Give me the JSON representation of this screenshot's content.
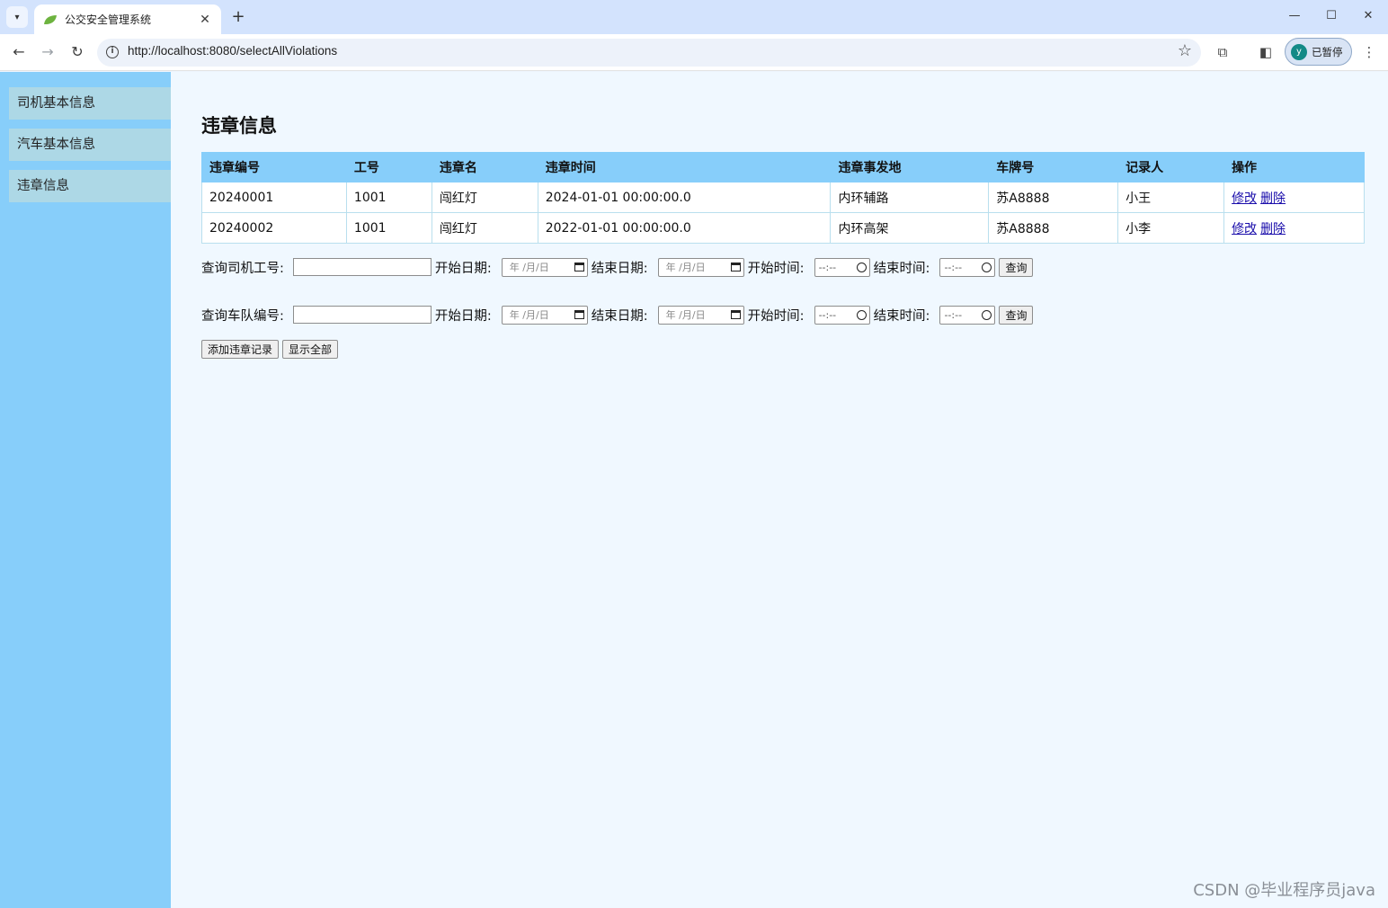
{
  "browser": {
    "tab_title": "公交安全管理系统",
    "url": "http://localhost:8080/selectAllViolations",
    "profile_initial": "y",
    "profile_label": "已暂停"
  },
  "sidebar": {
    "items": [
      {
        "label": "司机基本信息"
      },
      {
        "label": "汽车基本信息"
      },
      {
        "label": "违章信息"
      }
    ]
  },
  "main": {
    "title": "违章信息",
    "table": {
      "headers": [
        "违章编号",
        "工号",
        "违章名",
        "违章时间",
        "违章事发地",
        "车牌号",
        "记录人",
        "操作"
      ],
      "rows": [
        {
          "id": "20240001",
          "worker_no": "1001",
          "name": "闯红灯",
          "time": "2024-01-01 00:00:00.0",
          "place": "内环辅路",
          "plate": "苏A8888",
          "recorder": "小王",
          "edit": "修改",
          "delete": "删除"
        },
        {
          "id": "20240002",
          "worker_no": "1001",
          "name": "闯红灯",
          "time": "2022-01-01 00:00:00.0",
          "place": "内环高架",
          "plate": "苏A8888",
          "recorder": "小李",
          "edit": "修改",
          "delete": "删除"
        }
      ]
    },
    "query_driver": {
      "label": "查询司机工号:",
      "value": "",
      "start_date_label": "开始日期:",
      "end_date_label": "结束日期:",
      "start_time_label": "开始时间:",
      "end_time_label": "结束时间:",
      "date_placeholder": "年 /月/日",
      "time_placeholder": "--:--",
      "button": "查询"
    },
    "query_team": {
      "label": "查询车队编号:",
      "value": "",
      "start_date_label": "开始日期:",
      "end_date_label": "结束日期:",
      "start_time_label": "开始时间:",
      "end_time_label": "结束时间:",
      "date_placeholder": "年 /月/日",
      "time_placeholder": "--:--",
      "button": "查询"
    },
    "actions": {
      "add": "添加违章记录",
      "show_all": "显示全部"
    }
  },
  "watermark": "CSDN @毕业程序员java"
}
